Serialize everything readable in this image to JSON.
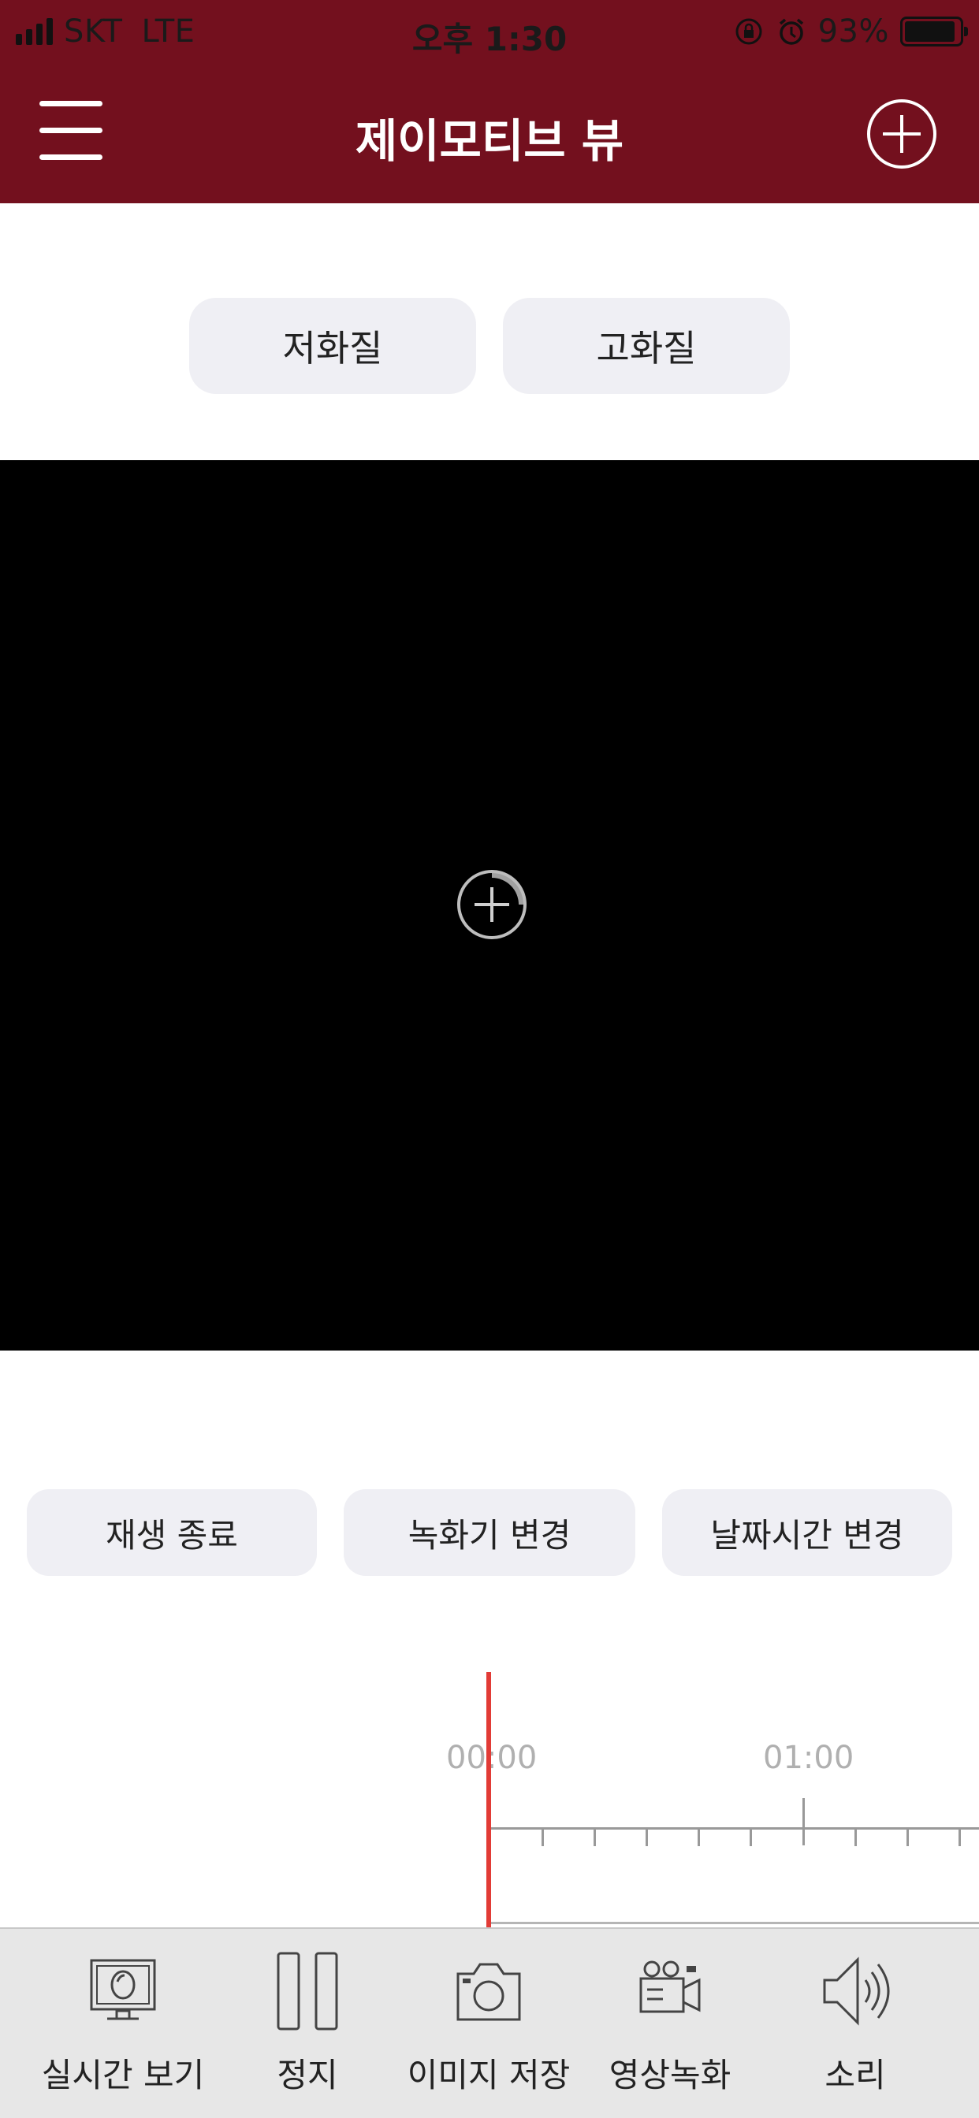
{
  "status_bar": {
    "carrier": "SKT",
    "network": "LTE",
    "time": "오후 1:30",
    "battery_percent_text": "93%",
    "battery_level": 0.93
  },
  "nav": {
    "title": "제이모티브 뷰",
    "icons": {
      "menu": "hamburger-menu-icon",
      "add": "plus-circle-icon"
    }
  },
  "quality": {
    "low": "저화질",
    "high": "고화질"
  },
  "video": {
    "overlay_icon": "zoom-plus-icon"
  },
  "controls": {
    "stop_playback": "재생 종료",
    "change_recorder": "녹화기 변경",
    "change_datetime": "날짜시간 변경"
  },
  "timeline": {
    "labels": [
      "00:00",
      "01:00"
    ]
  },
  "tabbar": {
    "items": [
      {
        "label": "실시간 보기",
        "icon": "monitor-icon"
      },
      {
        "label": "정지",
        "icon": "pause-icon"
      },
      {
        "label": "이미지 저장",
        "icon": "camera-icon"
      },
      {
        "label": "영상녹화",
        "icon": "video-camera-icon"
      },
      {
        "label": "소리",
        "icon": "speaker-icon"
      }
    ]
  },
  "colors": {
    "header_bg": "#73101e",
    "button_bg": "#efeff4",
    "playhead": "#e23b36",
    "tabbar_bg": "#e7e7e7"
  }
}
